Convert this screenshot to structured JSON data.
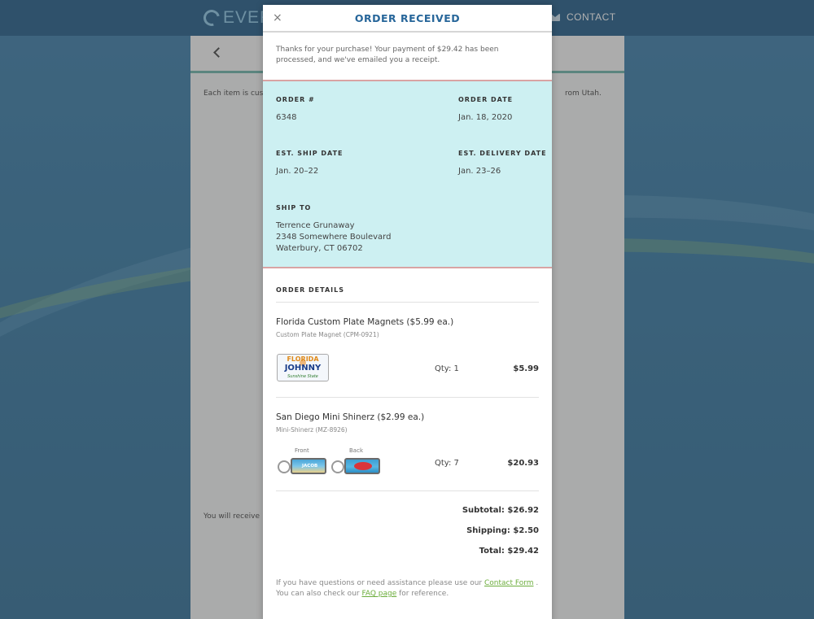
{
  "site": {
    "logo_text": "EVER",
    "nav_contact": "CONTACT",
    "panel_line1": "Each item is cust",
    "panel_line1_end": "rom Utah.",
    "panel_line2": "You will receive"
  },
  "modal": {
    "title": "ORDER RECEIVED",
    "close_symbol": "×",
    "intro": "Thanks for your purchase! Your payment of $29.42 has been processed, and we've emailed you a receipt.",
    "order_number_label": "ORDER #",
    "order_number": "6348",
    "order_date_label": "ORDER DATE",
    "order_date": "Jan. 18, 2020",
    "ship_date_label": "EST. SHIP DATE",
    "ship_date": "Jan. 20–22",
    "delivery_date_label": "EST. DELIVERY DATE",
    "delivery_date": "Jan. 23–26",
    "ship_to_label": "SHIP TO",
    "ship_to_name": "Terrence Grunaway",
    "ship_to_street": "2348 Somewhere Boulevard",
    "ship_to_city": "Waterbury, CT 06702",
    "details_title": "ORDER DETAILS",
    "items": [
      {
        "name": "Florida Custom Plate Magnets ($5.99 ea.)",
        "sku": "Custom Plate Magnet (CPM-0921)",
        "qty": "Qty: 1",
        "price": "$5.99",
        "plate_top": "FLORIDA",
        "plate_name": "JOHNNY",
        "plate_bottom": "Sunshine State"
      },
      {
        "name": "San Diego Mini Shinerz ($2.99 ea.)",
        "sku": "Mini-Shinerz (MZ-8926)",
        "qty": "Qty: 7",
        "price": "$20.93",
        "front_label": "Front",
        "back_label": "Back",
        "front_tag": "JACOB"
      }
    ],
    "subtotal": "Subtotal: $26.92",
    "shipping": "Shipping: $2.50",
    "total": "Total: $29.42",
    "footer_pre": "If you have questions or need assistance please use our ",
    "footer_contact_link": "Contact Form",
    "footer_mid": " . You can also check our ",
    "footer_faq_link": "FAQ page",
    "footer_post": " for reference."
  },
  "colors": {
    "title": "#27669a",
    "info_bg": "#cdf0f2",
    "info_border": "#d9a3a3",
    "link": "#6cad3c"
  }
}
